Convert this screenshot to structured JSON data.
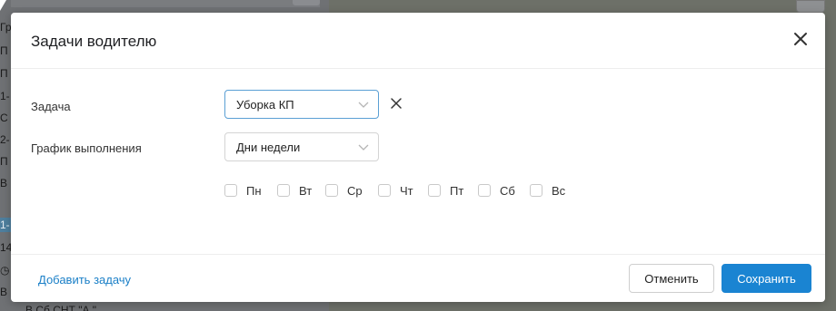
{
  "background": {
    "side_fragments": [
      "Гр",
      "П",
      "П",
      "1-",
      "С",
      "2-",
      "П",
      "В",
      "1-",
      "14",
      "◷",
      "В"
    ],
    "bottom_text": "В  Сб                   СНТ \"А               \""
  },
  "modal": {
    "title": "Задачи водителю",
    "task": {
      "label": "Задача",
      "value": "Уборка КП"
    },
    "schedule": {
      "label": "График выполнения",
      "value": "Дни недели"
    },
    "days": [
      "Пн",
      "Вт",
      "Ср",
      "Чт",
      "Пт",
      "Сб",
      "Вс"
    ],
    "footer": {
      "add_task": "Добавить задачу",
      "cancel": "Отменить",
      "save": "Сохранить"
    }
  },
  "colors": {
    "accent": "#1a84d2",
    "link": "#1a7fc7",
    "focus_border": "#5a9fd4"
  }
}
